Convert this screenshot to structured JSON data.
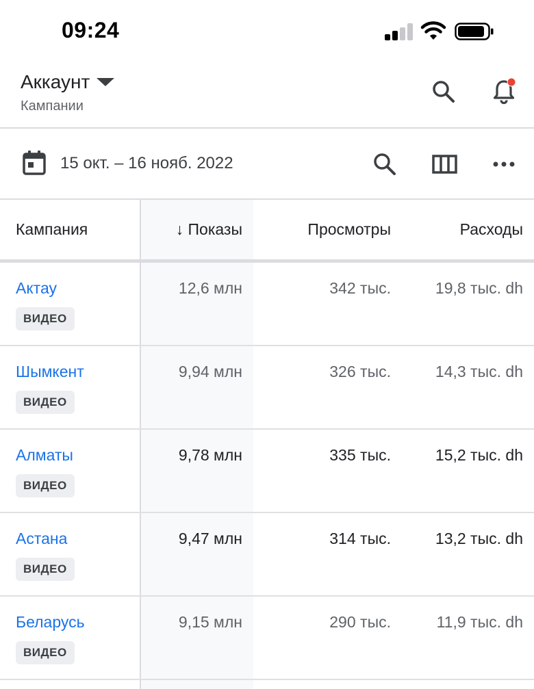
{
  "status_bar": {
    "time": "09:24"
  },
  "header": {
    "account_label": "Аккаунт",
    "subtitle": "Кампании",
    "notification_dot_color": "#ea4335"
  },
  "toolbar": {
    "date_range": "15 окт. – 16 нояб. 2022"
  },
  "table": {
    "columns": {
      "campaign": "Кампания",
      "impressions": "↓ Показы",
      "views": "Просмотры",
      "cost": "Расходы"
    },
    "rows": [
      {
        "name": "Актау",
        "badge": "ВИДЕО",
        "impressions": "12,6 млн",
        "views": "342 тыс.",
        "cost": "19,8 тыс. dh"
      },
      {
        "name": "Шымкент",
        "badge": "ВИДЕО",
        "impressions": "9,94 млн",
        "views": "326 тыс.",
        "cost": "14,3 тыс. dh"
      },
      {
        "name": "Алматы",
        "badge": "ВИДЕО",
        "impressions": "9,78 млн",
        "views": "335 тыс.",
        "cost": "15,2 тыс. dh"
      },
      {
        "name": "Астана",
        "badge": "ВИДЕО",
        "impressions": "9,47 млн",
        "views": "314 тыс.",
        "cost": "13,2 тыс. dh"
      },
      {
        "name": "Беларусь",
        "badge": "ВИДЕО",
        "impressions": "9,15 млн",
        "views": "290 тыс.",
        "cost": "11,9 тыс. dh"
      }
    ]
  },
  "colors": {
    "link": "#1a73e8",
    "divider": "#dadce0",
    "sorted_column_bg": "#f8f9fa"
  }
}
